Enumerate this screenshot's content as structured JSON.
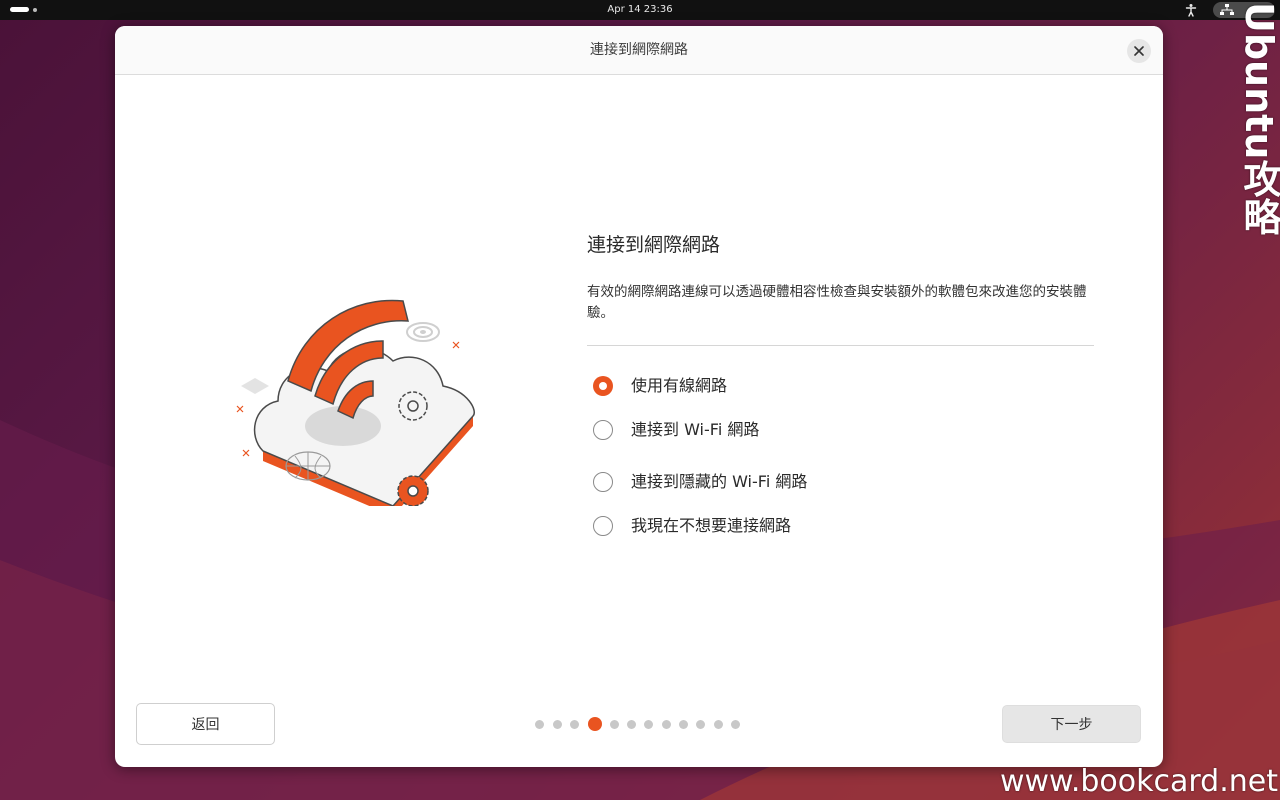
{
  "topbar": {
    "clock": "Apr 14  23:36"
  },
  "watermarks": {
    "vertical": "Ubuntu攻略",
    "bottom": "www.bookcard.net"
  },
  "dialog": {
    "title": "連接到網際網路",
    "heading": "連接到網際網路",
    "description": "有效的網際網路連線可以透過硬體相容性檢查與安裝額外的軟體包來改進您的安裝體驗。",
    "options": [
      {
        "label": "使用有線網路",
        "checked": true
      },
      {
        "label": "連接到 Wi-Fi 網路",
        "checked": false
      },
      {
        "label": "連接到隱藏的 Wi-Fi 網路",
        "checked": false
      },
      {
        "label": "我現在不想要連接網路",
        "checked": false
      }
    ],
    "back_label": "返回",
    "next_label": "下一步",
    "pager": {
      "total": 12,
      "current": 4
    }
  },
  "colors": {
    "accent": "#e95420",
    "topbar": "#111111",
    "dialog_bg": "#ffffff"
  },
  "icons": {
    "close": "close-icon",
    "accessibility": "accessibility-icon",
    "network": "network-icon",
    "illustration": "wifi-cloud-illustration"
  }
}
